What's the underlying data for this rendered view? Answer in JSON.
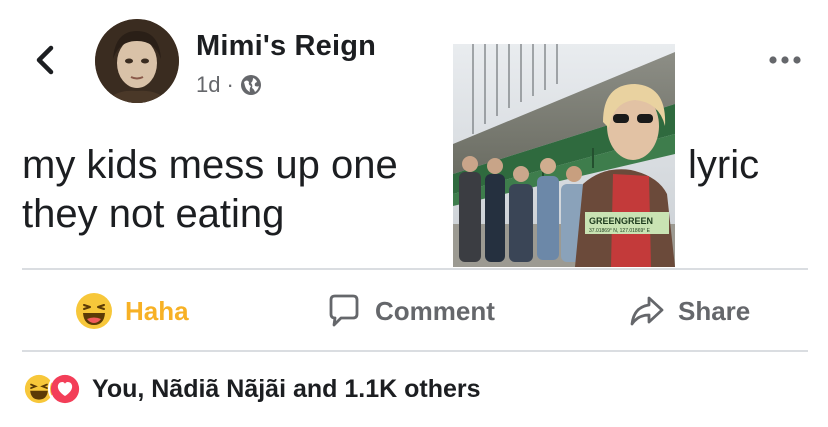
{
  "post": {
    "author": "Mimi's Reign",
    "age": "1d",
    "separator": "·",
    "text_line1": "my kids mess up one",
    "text_line2": "they not eating",
    "text_trailing": "lyric",
    "photo": {
      "album_title": "GREENGREEN",
      "album_subtitle": "37.01869° N, 127.01869° E"
    }
  },
  "actions": {
    "haha": "Haha",
    "comment": "Comment",
    "share": "Share"
  },
  "reactions": {
    "summary": "You, Nãdiã Nãjãi and 1.1K others",
    "types": [
      "haha-icon",
      "love-icon"
    ]
  },
  "icons": [
    "back-arrow-icon",
    "globe-icon",
    "more-icon",
    "haha-icon",
    "comment-icon",
    "share-icon",
    "love-icon"
  ],
  "colors": {
    "text": "#1c1e21",
    "secondary": "#65676b",
    "haha": "#f7b125",
    "love": "#f33e58",
    "divider": "#dadde1"
  }
}
